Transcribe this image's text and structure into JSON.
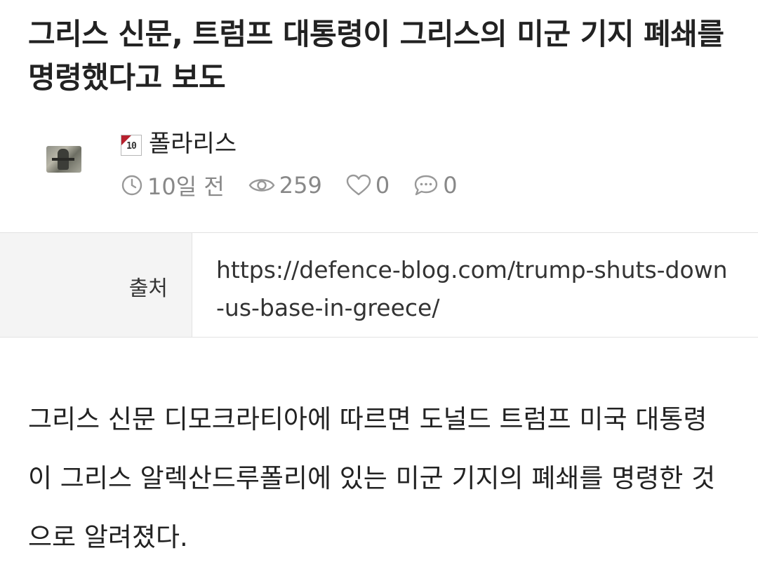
{
  "article": {
    "title": "그리스 신문, 트럼프 대통령이 그리스의 미군 기지 폐쇄를 명령했다고 보도",
    "author": {
      "name": "폴라리스",
      "level": "10",
      "level_badge_color": "#b7202e"
    },
    "stats": {
      "time": "10일 전",
      "views": "259",
      "likes": "0",
      "comments": "0",
      "time_icon": "clock-icon",
      "views_icon": "eye-icon",
      "likes_icon": "heart-icon",
      "comments_icon": "comment-bubble-icon"
    },
    "source": {
      "label": "출처",
      "url": "https://defence-blog.com/trump-shuts-down-us-base-in-greece/"
    },
    "body": "그리스 신문 디모크라티아에 따르면 도널드 트럼프 미국 대통령이 그리스 알렉산드루폴리에 있는 미군 기지의 폐쇄를 명령한 것으로 알려졌다."
  },
  "colors": {
    "text": "#222222",
    "muted": "#888888",
    "source_bg": "#f4f4f4",
    "border": "#e2e2e2"
  }
}
